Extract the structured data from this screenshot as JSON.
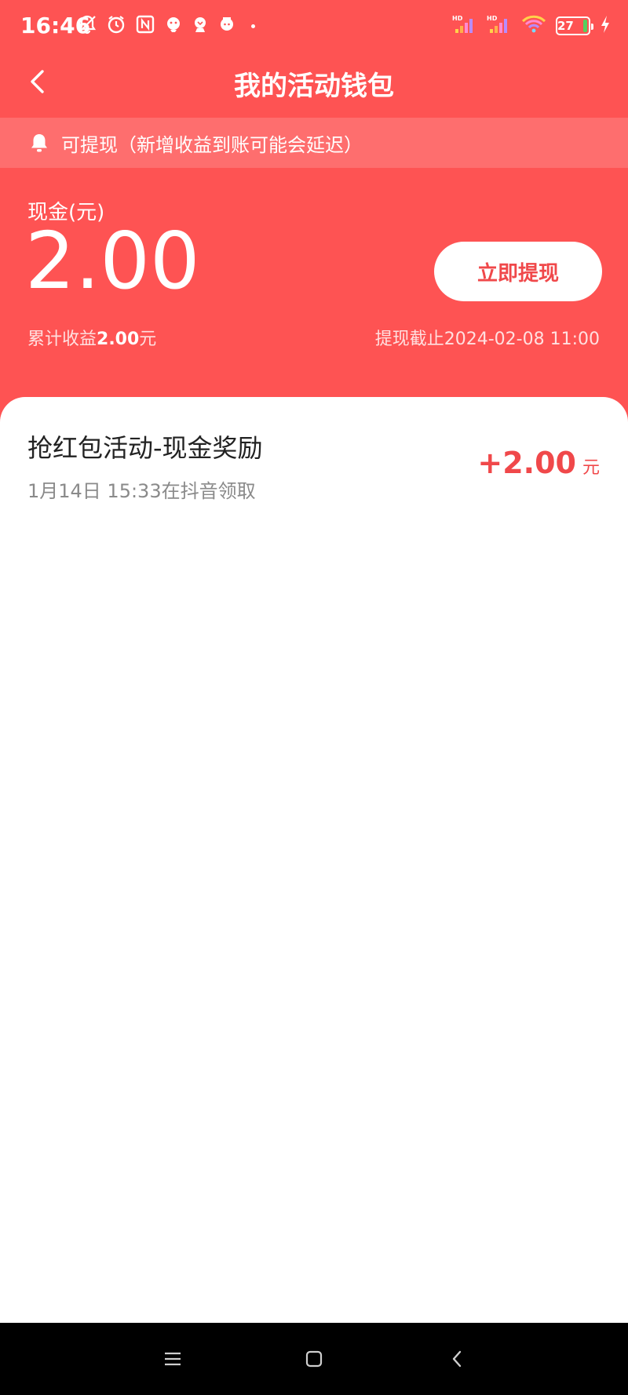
{
  "status_bar": {
    "time": "16:46",
    "battery": "27",
    "icons": [
      "bell-off-icon",
      "alarm-icon",
      "nfc-icon",
      "app-notification-icon",
      "app-notification-icon",
      "app-notification-icon",
      "signal-icon",
      "signal-icon",
      "wifi-icon",
      "charging-icon"
    ],
    "signal_label": "HD",
    "battery_color": "#54d05f"
  },
  "header": {
    "title": "我的活动钱包",
    "back_icon": "chevron-left-icon"
  },
  "notice": {
    "text": "可提现（新增收益到账可能会延迟）",
    "icon": "bell-icon"
  },
  "balance": {
    "label": "现金(元)",
    "amount": "2.00",
    "withdraw_button": "立即提现",
    "earnings_prefix": "累计收益",
    "earnings_value": "2.00",
    "earnings_suffix": "元",
    "deadline": "提现截止2024-02-08 11:00"
  },
  "records": [
    {
      "title": "抢红包活动-现金奖励",
      "subtitle": "1月14日 15:33在抖音领取",
      "amount": "+2.00",
      "unit": "元"
    }
  ],
  "system_nav": {
    "menu_icon": "menu-icon",
    "home_icon": "home-square-icon",
    "back_icon": "back-triangle-icon"
  },
  "colors": {
    "primary": "#fe5353",
    "accent_text": "#f0484a",
    "background": "#ffffff"
  }
}
